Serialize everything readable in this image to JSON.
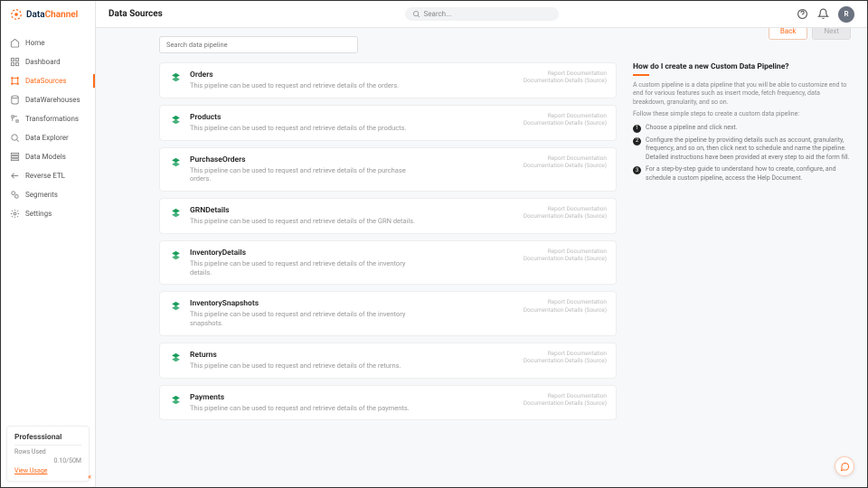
{
  "brand": {
    "part1": "Data",
    "part2": "Channel"
  },
  "header": {
    "title": "Data Sources",
    "search_placeholder": "Search..."
  },
  "avatar_letter": "R",
  "nav": [
    {
      "label": "Home"
    },
    {
      "label": "Dashboard"
    },
    {
      "label": "DataSources",
      "active": true
    },
    {
      "label": "DataWarehouses"
    },
    {
      "label": "Transformations"
    },
    {
      "label": "Data Explorer"
    },
    {
      "label": "Data Models"
    },
    {
      "label": "Reverse ETL"
    },
    {
      "label": "Segments"
    },
    {
      "label": "Settings"
    }
  ],
  "plan": {
    "name": "Professsional",
    "rows_label": "Rows Used",
    "rows_value": "0.10/50M",
    "usage_link": "View Usage"
  },
  "pipeline_search_placeholder": "Search data pipeline",
  "doc_link_1": "Report Documentation",
  "doc_link_2": "Documentation Details (Source)",
  "pipelines": [
    {
      "title": "Orders",
      "desc": "This pipeline can be used to request and retrieve details of the orders."
    },
    {
      "title": "Products",
      "desc": "This pipeline can be used to request and retrieve details of the products."
    },
    {
      "title": "PurchaseOrders",
      "desc": "This pipeline can be used to request and retrieve details of the purchase orders."
    },
    {
      "title": "GRNDetails",
      "desc": "This pipeline can be used to request and retrieve details of the GRN details."
    },
    {
      "title": "InventoryDetails",
      "desc": "This pipeline can be used to request and retrieve details of the inventory details."
    },
    {
      "title": "InventorySnapshots",
      "desc": "This pipeline can be used to request and retrieve details of the inventory snapshots."
    },
    {
      "title": "Returns",
      "desc": "This pipeline can be used to request and retrieve details of the returns."
    },
    {
      "title": "Payments",
      "desc": "This pipeline can be used to request and retrieve details of the payments."
    }
  ],
  "wizard": {
    "back": "Back",
    "next": "Next"
  },
  "help": {
    "title": "How do I create a new Custom Data Pipeline?",
    "p1": "A custom pipeline is a data pipeline that you will be able to customize end to end for various features such as insert mode, fetch frequency, data breakdown, granularity, and so on.",
    "p2": "Follow these simple steps to create a custom data pipeline:",
    "steps": [
      "Choose a pipeline and click next.",
      "Configure the pipeline by providing details such as account, granularity, frequency, and so on, then click next to schedule and name the pipeline. Detailed instructions have been provided at every step to aid the form fill.",
      "For a step-by-step guide to understand how to create, configure, and schedule a custom pipeline, access the Help Document."
    ]
  }
}
